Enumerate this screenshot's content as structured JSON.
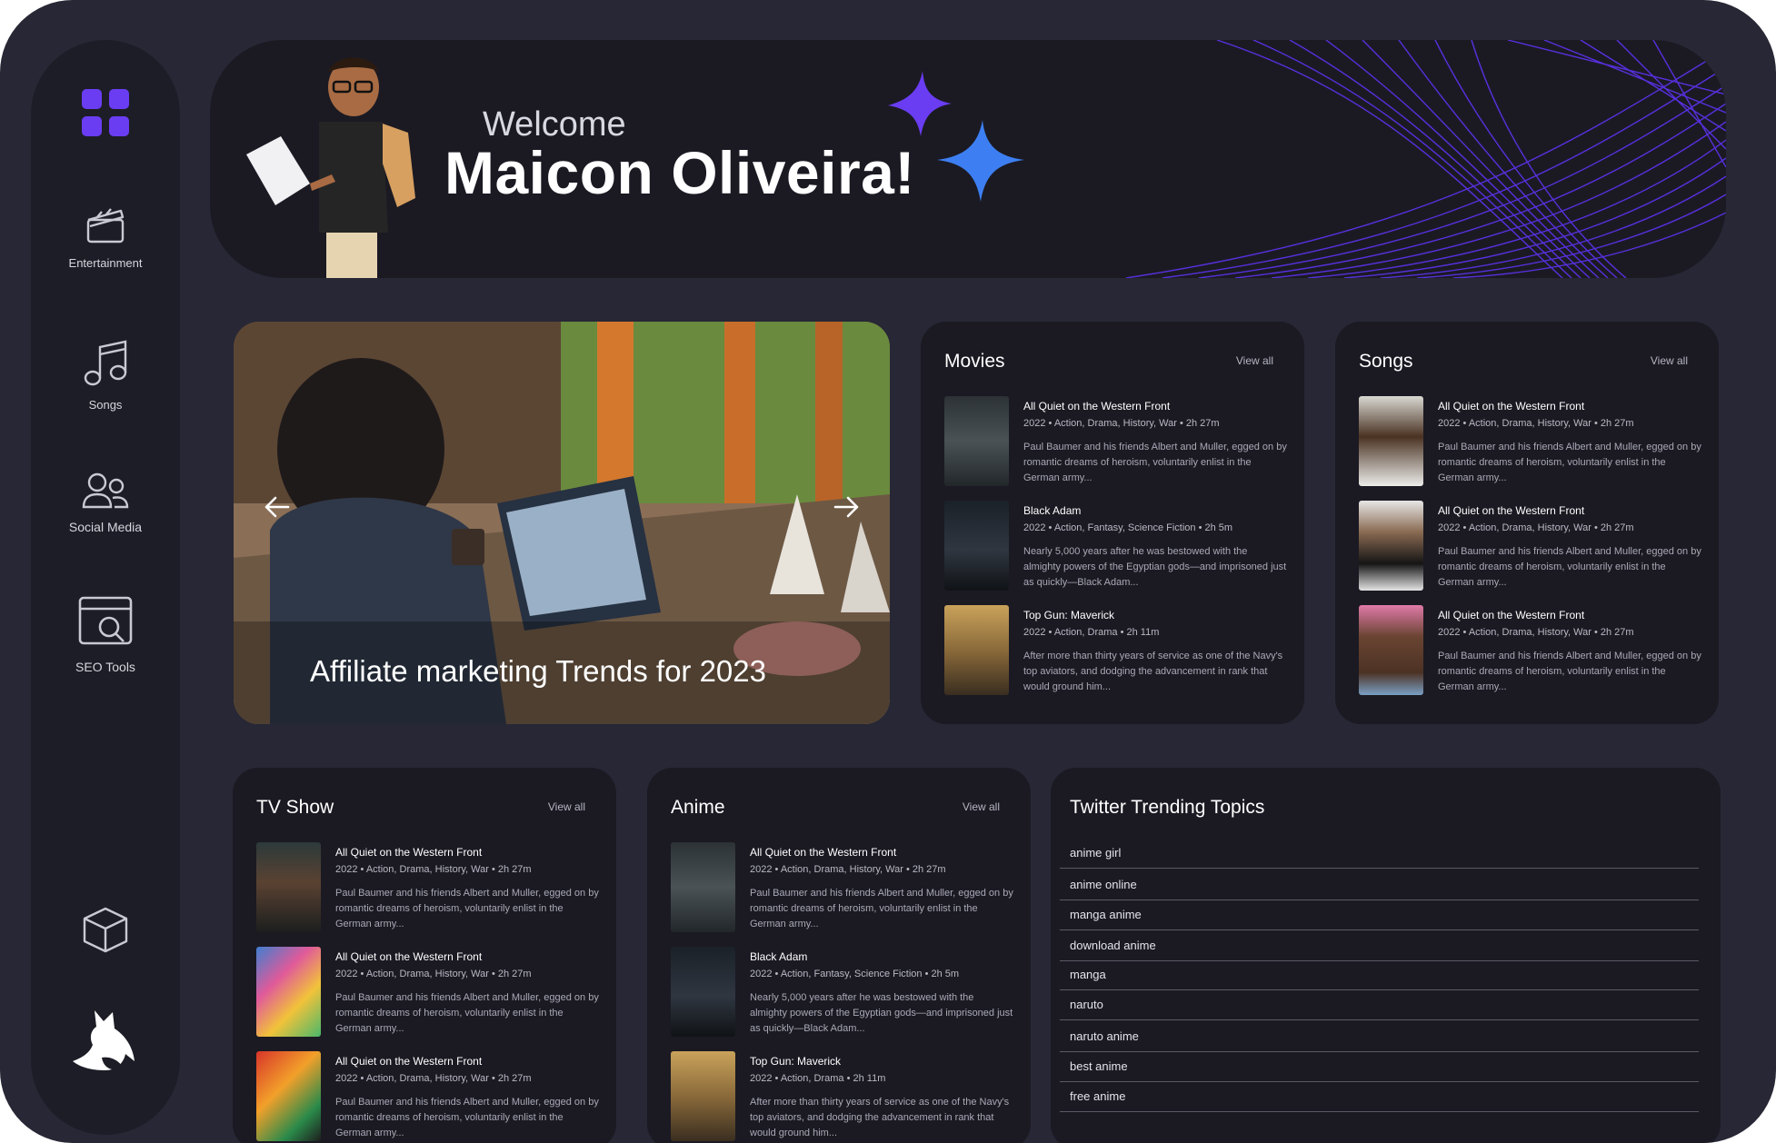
{
  "sidebar": {
    "items": [
      {
        "label": "Entertainment",
        "icon": "clapperboard-icon"
      },
      {
        "label": "Songs",
        "icon": "music-note-icon"
      },
      {
        "label": "Social Media",
        "icon": "users-icon"
      },
      {
        "label": "SEO Tools",
        "icon": "seo-search-icon"
      }
    ],
    "accent": "#6a3df2"
  },
  "hero": {
    "welcome": "Welcome",
    "name": "Maicon Oliveira!"
  },
  "feature": {
    "caption": "Affiliate marketing Trends for 2023"
  },
  "movies": {
    "title": "Movies",
    "view_all": "View all",
    "items": [
      {
        "title": "All Quiet on the Western Front",
        "meta": "2022 •  Action, Drama, History, War • 2h 27m",
        "desc": "Paul Baumer and his friends Albert and Muller, egged on by romantic dreams of heroism, voluntarily enlist in the German army..."
      },
      {
        "title": "Black Adam",
        "meta": "2022 •  Action, Fantasy, Science Fiction  • 2h 5m",
        "desc": "Nearly 5,000 years after he was bestowed with the almighty powers of the Egyptian gods—and imprisoned just as quickly—Black Adam..."
      },
      {
        "title": "Top Gun: Maverick",
        "meta": "2022 •  Action, Drama • 2h 11m",
        "desc": "After more than thirty years of service as one of the Navy's top aviators, and dodging the advancement in rank that would ground him..."
      }
    ]
  },
  "songs": {
    "title": "Songs",
    "view_all": "View all",
    "items": [
      {
        "title": "All Quiet on the Western Front",
        "meta": "2022 •  Action, Drama, History, War • 2h 27m",
        "desc": "Paul Baumer and his friends Albert and Muller, egged on by romantic dreams of heroism, voluntarily enlist in the German army..."
      },
      {
        "title": "All Quiet on the Western Front",
        "meta": "2022 •  Action, Drama, History, War • 2h 27m",
        "desc": "Paul Baumer and his friends Albert and Muller, egged on by romantic dreams of heroism, voluntarily enlist in the German army..."
      },
      {
        "title": "All Quiet on the Western Front",
        "meta": "2022 •  Action, Drama, History, War • 2h 27m",
        "desc": "Paul Baumer and his friends Albert and Muller, egged on by romantic dreams of heroism, voluntarily enlist in the German army..."
      }
    ]
  },
  "tvshow": {
    "title": "TV Show",
    "view_all": "View all",
    "items": [
      {
        "title": "All Quiet on the Western Front",
        "meta": "2022 •  Action, Drama, History, War • 2h 27m",
        "desc": "Paul Baumer and his friends Albert and Muller, egged on by romantic dreams of heroism, voluntarily enlist in the German army..."
      },
      {
        "title": "All Quiet on the Western Front",
        "meta": "2022 •  Action, Drama, History, War • 2h 27m",
        "desc": "Paul Baumer and his friends Albert and Muller, egged on by romantic dreams of heroism, voluntarily enlist in the German army..."
      },
      {
        "title": "All Quiet on the Western Front",
        "meta": "2022 •  Action, Drama, History, War • 2h 27m",
        "desc": "Paul Baumer and his friends Albert and Muller, egged on by romantic dreams of heroism, voluntarily enlist in the German army..."
      }
    ]
  },
  "anime": {
    "title": "Anime",
    "view_all": "View all",
    "items": [
      {
        "title": "All Quiet on the Western Front",
        "meta": "2022 •  Action, Drama, History, War • 2h 27m",
        "desc": "Paul Baumer and his friends Albert and Muller, egged on by romantic dreams of heroism, voluntarily enlist in the German army..."
      },
      {
        "title": "Black Adam",
        "meta": "2022 •  Action, Fantasy, Science Fiction  • 2h 5m",
        "desc": "Nearly 5,000 years after he was bestowed with the almighty powers of the Egyptian gods—and imprisoned just as quickly—Black Adam..."
      },
      {
        "title": "Top Gun: Maverick",
        "meta": "2022 •  Action, Drama • 2h 11m",
        "desc": "After more than thirty years of service as one of the Navy's top aviators, and dodging the advancement in rank that would ground him..."
      }
    ]
  },
  "twitter": {
    "title": "Twitter Trending Topics",
    "topics": [
      "anime girl",
      "anime online",
      "manga anime",
      "download anime",
      "manga",
      "naruto",
      "naruto anime",
      "best anime",
      "free anime"
    ]
  }
}
